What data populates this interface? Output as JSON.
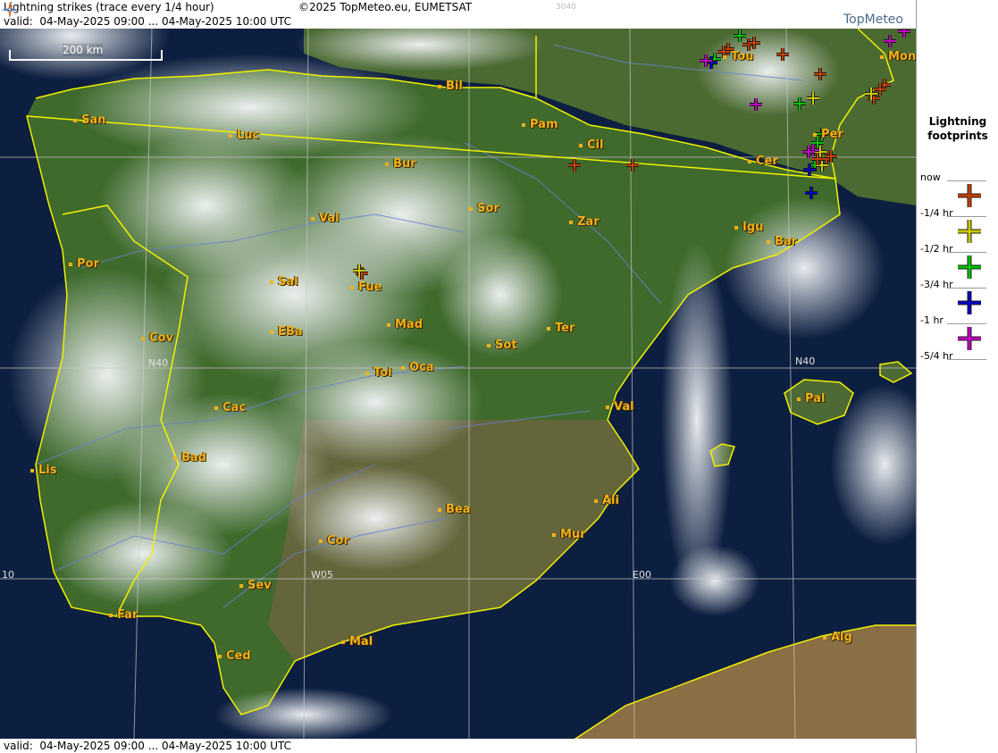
{
  "header": {
    "title": "Lightning strikes (trace every 1/4 hour)",
    "copyright": "©2025 TopMeteo.eu, EUMETSAT",
    "code": "3040",
    "valid": "valid:  04-May-2025 09:00 ... 04-May-2025 10:00 UTC",
    "brand": "TopMeteo"
  },
  "footer": {
    "valid": "valid:  04-May-2025 09:00 ... 04-May-2025 10:00 UTC"
  },
  "scale": {
    "label": "200 km"
  },
  "grid_labels": [
    "N40",
    "N40",
    "W05",
    "E00",
    "10"
  ],
  "cities": [
    "San",
    "Luc",
    "Bil",
    "Pam",
    "Tou",
    "Mon",
    "Cil",
    "Bur",
    "Per",
    "Cer",
    "Val",
    "Sor",
    "Zar",
    "Igu",
    "Bar",
    "Por",
    "Sal",
    "Fue",
    "Mad",
    "EBa",
    "Cov",
    "Ter",
    "Sot",
    "Tol",
    "Oca",
    "Cac",
    "Val",
    "Pal",
    "Bad",
    "Lis",
    "Ali",
    "Bea",
    "Mur",
    "Cor",
    "Sev",
    "Far",
    "Mal",
    "Ced",
    "Alg"
  ],
  "legend": {
    "title_line1": "Lightning",
    "title_line2": "footprints",
    "rows": [
      {
        "label": "now",
        "color": "#c04000"
      },
      {
        "label": "-1/4 hr",
        "color": "#c8c800"
      },
      {
        "label": "-1/2 hr",
        "color": "#00c000"
      },
      {
        "label": "-3/4 hr",
        "color": "#0000c0"
      },
      {
        "label": "-1 hr",
        "color": "#c000c0"
      },
      {
        "label": "-5/4 hr",
        "color": ""
      }
    ]
  },
  "colors": {
    "border": "#f0f000",
    "city_label": "#f2b21a",
    "river": "#6a7fd0",
    "grid": "#c8c8c8"
  }
}
